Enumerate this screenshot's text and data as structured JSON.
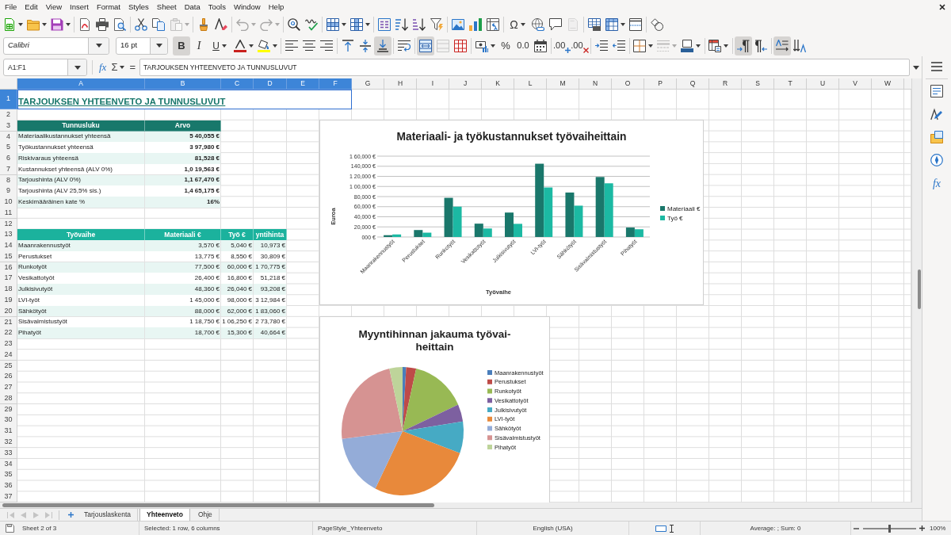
{
  "menu_bar": {
    "items": [
      "File",
      "Edit",
      "View",
      "Insert",
      "Format",
      "Styles",
      "Sheet",
      "Data",
      "Tools",
      "Window",
      "Help"
    ]
  },
  "standard_toolbar": [
    {
      "disabled": false
    },
    {
      "disabled": false
    },
    {
      "disabled": false
    },
    {
      "disabled": false
    },
    {
      "disabled": false
    },
    {
      "disabled": false
    },
    {
      "disabled": false
    },
    {
      "disabled": false
    },
    {
      "disabled": true
    },
    {
      "disabled": false
    },
    {
      "disabled": false
    },
    {
      "disabled": true
    },
    {
      "disabled": true
    },
    {
      "disabled": false
    },
    {
      "disabled": false
    },
    {
      "disabled": false
    },
    {
      "disabled": false
    },
    {
      "disabled": false
    },
    {
      "disabled": false
    },
    {
      "disabled": false
    },
    {
      "disabled": false
    },
    {
      "disabled": false
    },
    {
      "disabled": false
    },
    {
      "disabled": false
    },
    {
      "label": "Ω",
      "disabled": false
    },
    {
      "disabled": false
    },
    {
      "disabled": false
    },
    {
      "disabled": true
    },
    {
      "disabled": false
    },
    {
      "disabled": false
    },
    {
      "disabled": false
    },
    {
      "disabled": false
    }
  ],
  "formatting_toolbar": {
    "font_name": "Calibri",
    "font_size": "16 pt",
    "buttons": [
      {
        "label": "B",
        "on": true,
        "disabled": false
      },
      {
        "label": "I",
        "on": false,
        "disabled": false
      },
      {
        "label": "U",
        "on": false,
        "disabled": false
      },
      {
        "on": false,
        "disabled": false
      },
      {
        "on": false,
        "disabled": false
      },
      {
        "on": false,
        "disabled": false
      },
      {
        "on": false,
        "disabled": false
      },
      {
        "on": false,
        "disabled": false
      },
      {
        "on": false,
        "disabled": false
      },
      {
        "on": false,
        "disabled": false
      },
      {
        "on": true,
        "disabled": false
      },
      {
        "on": false,
        "disabled": false
      },
      {
        "on": true,
        "disabled": false
      },
      {
        "on": false,
        "disabled": true
      },
      {
        "on": false,
        "disabled": false
      },
      {
        "on": false,
        "disabled": false
      },
      {
        "label": "%",
        "on": false,
        "disabled": false
      },
      {
        "label": "0.0",
        "on": false,
        "disabled": false
      },
      {
        "on": false,
        "disabled": false
      },
      {
        "label": ".00",
        "on": false,
        "disabled": false
      },
      {
        "label": ".00",
        "on": false,
        "disabled": false
      },
      {
        "on": false,
        "disabled": false
      },
      {
        "on": false,
        "disabled": false
      },
      {
        "on": false,
        "disabled": false
      },
      {
        "on": false,
        "disabled": true
      },
      {
        "on": false,
        "disabled": false
      },
      {
        "on": false,
        "disabled": false
      },
      {
        "on": true,
        "disabled": false
      },
      {
        "on": false,
        "disabled": false
      },
      {
        "on": true,
        "disabled": false
      },
      {
        "on": false,
        "disabled": false
      }
    ]
  },
  "formula_bar": {
    "name_box": "A1:F1",
    "function_wizard": "fx",
    "sum": "Σ",
    "formula": "=",
    "content": "TARJOUKSEN YHTEENVETO JA TUNNUSLUVUT"
  },
  "sidebar": {
    "functions_label": "fx"
  },
  "sheet": {
    "columns": [
      {
        "label": "A",
        "selected": true
      },
      {
        "label": "B",
        "selected": true
      },
      {
        "label": "C",
        "selected": true
      },
      {
        "label": "D",
        "selected": true
      },
      {
        "label": "E",
        "selected": true
      },
      {
        "label": "F",
        "selected": true
      },
      {
        "label": "G",
        "selected": false
      },
      {
        "label": "H",
        "selected": false
      },
      {
        "label": "I",
        "selected": false
      },
      {
        "label": "J",
        "selected": false
      },
      {
        "label": "K",
        "selected": false
      },
      {
        "label": "L",
        "selected": false
      },
      {
        "label": "M",
        "selected": false
      },
      {
        "label": "N",
        "selected": false
      },
      {
        "label": "O",
        "selected": false
      },
      {
        "label": "P",
        "selected": false
      },
      {
        "label": "Q",
        "selected": false
      },
      {
        "label": "R",
        "selected": false
      },
      {
        "label": "S",
        "selected": false
      },
      {
        "label": "T",
        "selected": false
      },
      {
        "label": "U",
        "selected": false
      },
      {
        "label": "V",
        "selected": false
      },
      {
        "label": "W",
        "selected": false
      }
    ],
    "rows": [
      {
        "number": "1",
        "selected": true,
        "kind": "title",
        "shaded": false,
        "cells": [
          "TARJOUKSEN YHTEENVETO JA TUNNUSLUVUT"
        ]
      },
      {
        "number": "2",
        "selected": false,
        "kind": "blank",
        "shaded": false
      },
      {
        "number": "3",
        "selected": false,
        "kind": "keyhead",
        "cells": [
          "Tunnusluku",
          "Arvo"
        ]
      },
      {
        "number": "4",
        "selected": false,
        "kind": "key",
        "shaded": true,
        "cells": [
          "Materiaalikustannukset yhteensä",
          "5 40,055 €"
        ]
      },
      {
        "number": "5",
        "selected": false,
        "kind": "key",
        "shaded": false,
        "cells": [
          "Työkustannukset yhteensä",
          "3 97,980 €"
        ]
      },
      {
        "number": "6",
        "selected": false,
        "kind": "key",
        "shaded": true,
        "cells": [
          "Riskivaraus yhteensä",
          "81,528 €"
        ]
      },
      {
        "number": "7",
        "selected": false,
        "kind": "key",
        "shaded": false,
        "cells": [
          "Kustannukset yhteensä (ALV 0%)",
          "1,0 19,563 €"
        ]
      },
      {
        "number": "8",
        "selected": false,
        "kind": "key",
        "shaded": true,
        "cells": [
          "Tarjoushinta (ALV 0%)",
          "1,1 67,470 €"
        ]
      },
      {
        "number": "9",
        "selected": false,
        "kind": "key",
        "shaded": false,
        "cells": [
          "Tarjoushinta (ALV 25,5% sis.)",
          "1,4 65,175 €"
        ]
      },
      {
        "number": "10",
        "selected": false,
        "kind": "key",
        "shaded": true,
        "cells": [
          "Keskimääräinen kate %",
          "16%"
        ]
      },
      {
        "number": "11",
        "selected": false,
        "kind": "blank",
        "shaded": false
      },
      {
        "number": "12",
        "selected": false,
        "kind": "blank",
        "shaded": false
      },
      {
        "number": "13",
        "selected": false,
        "kind": "phasehead",
        "cells": [
          "Työvaihe",
          "Materiaali €",
          "Työ €",
          "yntihinta"
        ]
      },
      {
        "number": "14",
        "selected": false,
        "kind": "phase",
        "shaded": true,
        "cells": [
          "Maanrakennustyöt",
          "3,570 €",
          "5,040 €",
          "10,973 €"
        ]
      },
      {
        "number": "15",
        "selected": false,
        "kind": "phase",
        "shaded": false,
        "cells": [
          "Perustukset",
          "13,775 €",
          "8,550 €",
          "30,809 €"
        ]
      },
      {
        "number": "16",
        "selected": false,
        "kind": "phase",
        "shaded": true,
        "cells": [
          "Runkotyöt",
          "77,500 €",
          "60,000 €",
          "1 70,775 €"
        ]
      },
      {
        "number": "17",
        "selected": false,
        "kind": "phase",
        "shaded": false,
        "cells": [
          "Vesikattotyöt",
          "26,400 €",
          "16,800 €",
          "51,218 €"
        ]
      },
      {
        "number": "18",
        "selected": false,
        "kind": "phase",
        "shaded": true,
        "cells": [
          "Julkisivutyöt",
          "48,360 €",
          "26,040 €",
          "93,208 €"
        ]
      },
      {
        "number": "19",
        "selected": false,
        "kind": "phase",
        "shaded": false,
        "cells": [
          "LVI-työt",
          "1 45,000 €",
          "98,000 €",
          "3 12,984 €"
        ]
      },
      {
        "number": "20",
        "selected": false,
        "kind": "phase",
        "shaded": true,
        "cells": [
          "Sähkötyöt",
          "88,000 €",
          "62,000 €",
          "1 83,060 €"
        ]
      },
      {
        "number": "21",
        "selected": false,
        "kind": "phase",
        "shaded": false,
        "cells": [
          "Sisävalmistustyöt",
          "1 18,750 €",
          "1 06,250 €",
          "2 73,780 €"
        ]
      },
      {
        "number": "22",
        "selected": false,
        "kind": "phase",
        "shaded": true,
        "cells": [
          "Pihatyöt",
          "18,700 €",
          "15,300 €",
          "40,664 €"
        ]
      },
      {
        "number": "23",
        "selected": false,
        "kind": "blank",
        "shaded": false
      },
      {
        "number": "24",
        "selected": false,
        "kind": "blank",
        "shaded": false
      },
      {
        "number": "25",
        "selected": false,
        "kind": "blank",
        "shaded": false
      },
      {
        "number": "26",
        "selected": false,
        "kind": "blank",
        "shaded": false
      },
      {
        "number": "27",
        "selected": false,
        "kind": "blank",
        "shaded": false
      },
      {
        "number": "28",
        "selected": false,
        "kind": "blank",
        "shaded": false
      },
      {
        "number": "29",
        "selected": false,
        "kind": "blank",
        "shaded": false
      },
      {
        "number": "30",
        "selected": false,
        "kind": "blank",
        "shaded": false
      },
      {
        "number": "31",
        "selected": false,
        "kind": "blank",
        "shaded": false
      },
      {
        "number": "32",
        "selected": false,
        "kind": "blank",
        "shaded": false
      },
      {
        "number": "33",
        "selected": false,
        "kind": "blank",
        "shaded": false
      },
      {
        "number": "34",
        "selected": false,
        "kind": "blank",
        "shaded": false
      },
      {
        "number": "35",
        "selected": false,
        "kind": "blank",
        "shaded": false
      },
      {
        "number": "36",
        "selected": false,
        "kind": "blank",
        "shaded": false
      },
      {
        "number": "37",
        "selected": false,
        "kind": "blank",
        "shaded": false
      }
    ],
    "charts": [
      {
        "chart_data": {
          "type": "bar",
          "title": "Materiaali- ja työkustannukset työvaiheittain",
          "xlabel": "Työvaihe",
          "ylabel": "Euroa",
          "categories": [
            "Maanrakennustyöt",
            "Perustukset",
            "Runkotyöt",
            "Vesikattotyöt",
            "Julkisivutyöt",
            "LVI-työt",
            "Sähkötyöt",
            "Sisävalmistustyöt",
            "Pihatyöt"
          ],
          "series": [
            {
              "name": "Materiaali €",
              "color": "#1a776b",
              "values": [
                3570,
                13775,
                77500,
                26400,
                48360,
                145000,
                88000,
                118750,
                18700
              ]
            },
            {
              "name": "Työ €",
              "color": "#1cb9a3",
              "values": [
                5040,
                8550,
                60000,
                16800,
                26040,
                98000,
                62000,
                106250,
                15300
              ]
            }
          ],
          "ylim": [
            0,
            160000
          ],
          "yticks": [
            {
              "value": 0,
              "label": "000 €"
            },
            {
              "value": 20000,
              "label": "20,000 €"
            },
            {
              "value": 40000,
              "label": "40,000 €"
            },
            {
              "value": 60000,
              "label": "60,000 €"
            },
            {
              "value": 80000,
              "label": "80,000 €"
            },
            {
              "value": 100000,
              "label": "1 00,000 €"
            },
            {
              "value": 120000,
              "label": "1 20,000 €"
            },
            {
              "value": 140000,
              "label": "140,000 €"
            },
            {
              "value": 160000,
              "label": "1 60,000 €"
            }
          ],
          "grid": true,
          "legend": "right"
        }
      },
      {
        "chart_data": {
          "type": "pie",
          "title": "Myyntihinnan jakauma työvai-heittain",
          "categories": [
            "Maanrakennustyöt",
            "Perustukset",
            "Runkotyöt",
            "Vesikattotyöt",
            "Julkisivutyöt",
            "LVI-työt",
            "Sähkötyöt",
            "Sisävalmistustyöt",
            "Pihatyöt"
          ],
          "values": [
            0.94,
            2.64,
            14.63,
            4.39,
            7.98,
            26.81,
            15.68,
            23.45,
            3.48
          ],
          "colors": [
            "#4a7ebb",
            "#be4b48",
            "#98b954",
            "#7d60a0",
            "#46aac4",
            "#e8893b",
            "#94acd8",
            "#d69392",
            "#bed49a"
          ],
          "legend": "right"
        }
      }
    ]
  },
  "sheet_navigation": [
    {
      "disabled": true
    },
    {
      "disabled": true
    },
    {
      "disabled": true
    },
    {
      "disabled": true
    }
  ],
  "sheet_tabs": [
    {
      "label": "Tarjouslaskenta",
      "selected": false
    },
    {
      "label": "Yhteenveto",
      "selected": true
    },
    {
      "label": "Ohje",
      "selected": false
    }
  ],
  "status_bar": {
    "sheet": "Sheet 2 of 3",
    "selection": "Selected: 1 row, 6 columns",
    "page_style": "PageStyle_Yhteenveto",
    "language": "English (USA)",
    "summary": "Average: ; Sum: 0",
    "zoom": {
      "level": 0.5,
      "reading": "100%"
    }
  }
}
